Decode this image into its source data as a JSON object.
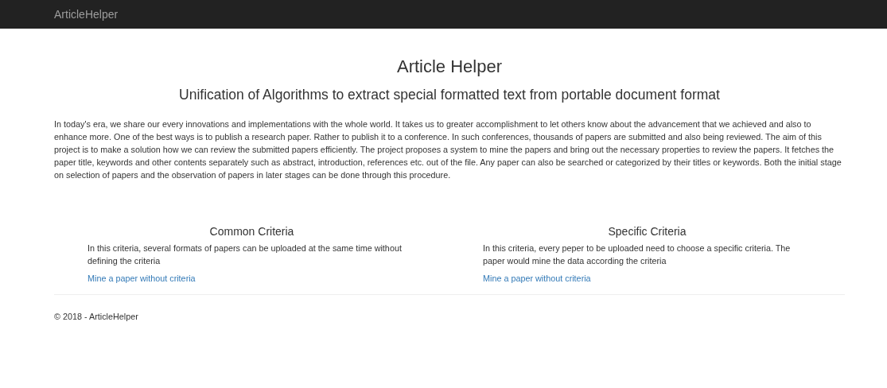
{
  "navbar": {
    "brand": "ArticleHelper"
  },
  "title": "Article Helper",
  "subtitle": "Unification of Algorithms to extract special formatted text from portable document format",
  "description": "In today's era, we share our every innovations and implementations with the whole world. It takes us to greater accomplishment to let others know about the advancement that we achieved and also to enhance more. One of the best ways is to publish a research paper. Rather to publish it to a conference. In such conferences, thousands of papers are submitted and also being reviewed. The aim of this project is to make a solution how we can review the submitted papers efficiently. The project proposes a system to mine the papers and bring out the necessary properties to review the papers. It fetches the paper title, keywords and other contents separately such as abstract, introduction, references etc. out of the file. Any paper can also be searched or categorized by their titles or keywords. Both the initial stage on selection of papers and the observation of papers in later stages can be done through this procedure.",
  "criteria": [
    {
      "heading": "Common Criteria",
      "text": "In this criteria, several formats of papers can be uploaded at the same time without defining the criteria",
      "link": "Mine a paper without criteria"
    },
    {
      "heading": "Specific Criteria",
      "text": "In this criteria, every peper to be uploaded need to choose a specific criteria. The paper would mine the data according the criteria",
      "link": "Mine a paper without criteria"
    }
  ],
  "footer": "© 2018 - ArticleHelper"
}
